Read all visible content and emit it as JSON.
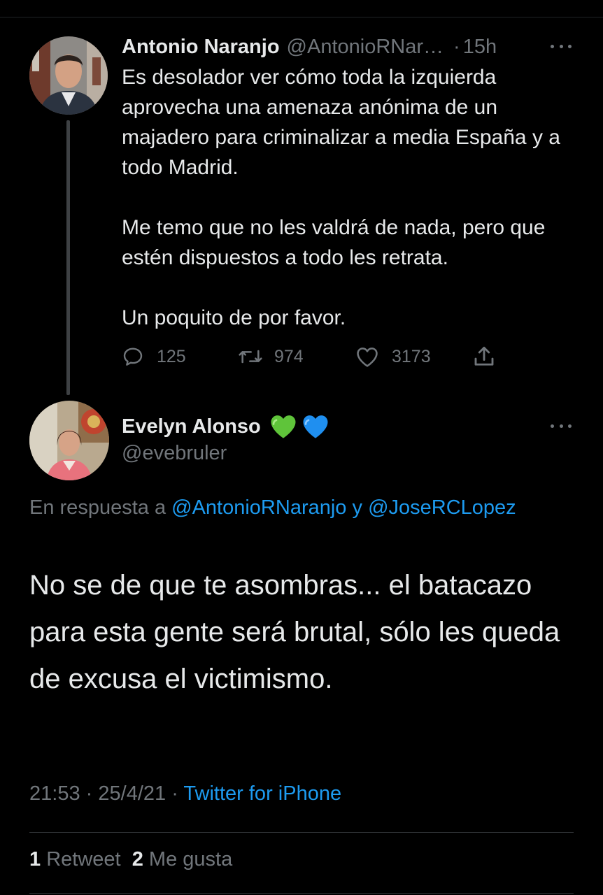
{
  "parent_tweet": {
    "author_name": "Antonio Naranjo",
    "author_handle": "@AntonioRNar…",
    "separator": "·",
    "time": "15h",
    "paragraphs": [
      "Es desolador ver cómo toda la izquierda aprovecha una amenaza anónima de un majadero para criminalizar a media España y a todo Madrid.",
      "Me temo que no les valdrá de nada, pero que estén dispuestos a todo les retrata.",
      "Un poquito de por favor."
    ],
    "actions": {
      "replies": "125",
      "retweets": "974",
      "likes": "3173"
    },
    "icons": [
      "reply-icon",
      "retweet-icon",
      "like-icon",
      "share-icon",
      "more-icon"
    ]
  },
  "reply_tweet": {
    "author_name": "Evelyn Alonso",
    "name_emojis": [
      "green-heart",
      "blue-heart"
    ],
    "author_handle": "@evebruler",
    "in_reply_to": {
      "prefix": "En respuesta a",
      "mention_1": "@AntonioRNaranjo",
      "connector": "y",
      "mention_2": "@JoseRCLopez"
    },
    "text": "No se de que te asombras... el batacazo para esta gente será brutal, sólo les queda de excusa el victimismo.",
    "time": "21:53",
    "separator": "·",
    "date": "25/4/21",
    "source": "Twitter for iPhone",
    "stats": {
      "retweet_count": "1",
      "retweet_label": "Retweet",
      "like_count": "2",
      "like_label": "Me gusta"
    }
  },
  "colors": {
    "background": "#000000",
    "text": "#e7e9ea",
    "secondary": "#71767b",
    "link": "#1d9bf0",
    "divider": "#2f3336"
  }
}
